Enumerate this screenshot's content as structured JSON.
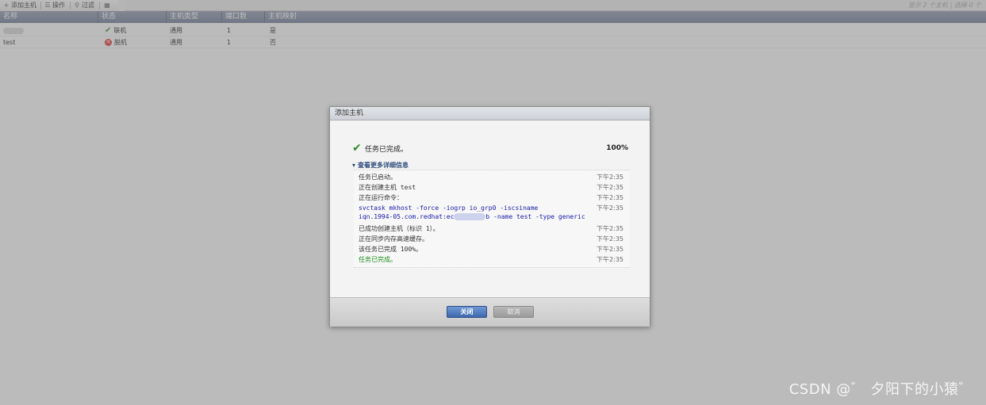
{
  "toolbar": {
    "add_host": "添加主机",
    "actions": "操作",
    "filter": "过滤",
    "status_right": "显示 2 个主机 | 选择 0 个"
  },
  "grid": {
    "headers": [
      "名称",
      "状态",
      "主机类型",
      "端口数",
      "主机映射"
    ],
    "rows": [
      {
        "name": "",
        "status": "联机",
        "type": "通用",
        "ports": "1",
        "mapping": "是"
      },
      {
        "name": "test",
        "status": "脱机",
        "type": "通用",
        "ports": "1",
        "mapping": "否"
      }
    ]
  },
  "dialog": {
    "title": "添加主机",
    "status_text": "任务已完成。",
    "progress": "100%",
    "details_label": "查看更多详细信息",
    "log": [
      {
        "msg": "任务已启动。",
        "time": "下午2:35",
        "kind": "normal"
      },
      {
        "msg": "正在创建主机 test",
        "time": "下午2:35",
        "kind": "normal"
      },
      {
        "msg": "正在运行命令：",
        "time": "下午2:35",
        "kind": "normal"
      },
      {
        "msg": "svctask mkhost -force -iogrp io_grp0 -iscsiname",
        "time": "下午2:35",
        "kind": "cmd"
      },
      {
        "msg": "iqn.1994-05.com.redhat:ec",
        "msg_tail": "b -name test -type generic",
        "time": "",
        "kind": "cmd"
      },
      {
        "msg": "已成功创建主机（标识 1）。",
        "time": "下午2:35",
        "kind": "normal"
      },
      {
        "msg": "正在同步内存高速缓存。",
        "time": "下午2:35",
        "kind": "normal"
      },
      {
        "msg": "该任务已完成 100%。",
        "time": "下午2:35",
        "kind": "normal"
      },
      {
        "msg": "任务已完成。",
        "time": "下午2:35",
        "kind": "done"
      }
    ],
    "close_label": "关闭",
    "cancel_label": "取消"
  },
  "watermark": "CSDN @゛ 夕阳下的小猿゛"
}
